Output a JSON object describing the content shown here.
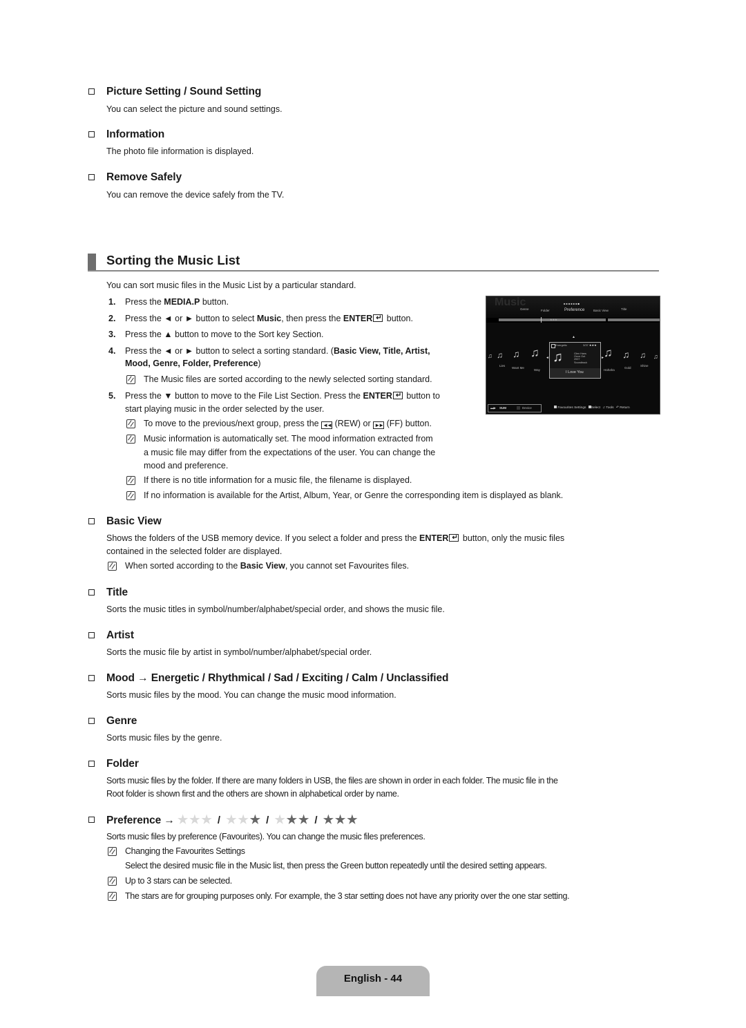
{
  "sections_top": [
    {
      "heading": "Picture Setting / Sound Setting",
      "text": "You can select the picture and sound settings."
    },
    {
      "heading": "Information",
      "text": "The photo file information is displayed."
    },
    {
      "heading": "Remove Safely",
      "text": "You can remove the device safely from the TV."
    }
  ],
  "main": {
    "title": "Sorting the Music List",
    "intro": "You can sort music files in the Music List by a particular standard.",
    "steps": [
      {
        "num": "1.",
        "pre": "Press the ",
        "bold": "MEDIA.P",
        "post": " button."
      },
      {
        "num": "2.",
        "pre": "Press the ◄ or ► button to select ",
        "bold": "Music",
        "mid": ", then press the ",
        "bold2": "ENTER",
        "post": " button."
      },
      {
        "num": "3.",
        "text": "Press the ▲ button to move to the Sort key Section."
      },
      {
        "num": "4.",
        "pre": "Press the ◄ or ► button to select a sorting standard. (",
        "bold": "Basic View, Title, Artist,",
        "line2_bold": "Mood, Genre, Folder, Preference",
        "line2_post": ")"
      },
      {
        "num": "5.",
        "pre": "Press the ▼ button to move to the File List Section. Press the ",
        "bold": "ENTER",
        "post": " button to",
        "line2": "start playing music in the order selected by the user."
      }
    ],
    "notes_step4": [
      "The Music files are sorted according to the newly selected sorting standard."
    ],
    "notes_step5": {
      "rew_ff": {
        "pre": "To move to the previous/next group, press the ",
        "rew": "(REW) or ",
        "ff": "(FF) button."
      },
      "mood": [
        "Music information is automatically set. The mood information extracted from",
        "a music file may differ from the expectations of the user. You can change the",
        "mood and preference."
      ],
      "no_title": "If there is no title information for a music file, the filename is displayed.",
      "no_info": "If no information is available for the Artist, Album, Year, or Genre the corresponding item is displayed as blank."
    }
  },
  "tv_screen": {
    "title": "Music",
    "sort_tabs": [
      "Genre",
      "Folder",
      "Preference",
      "Basic View",
      "Title"
    ],
    "selected_sort": "Preference",
    "group_label": "★★★",
    "tracks_left": [
      "Lies",
      "Want Me",
      "Way"
    ],
    "tracks_right": [
      "Hahaha",
      "Gold",
      "Shine"
    ],
    "selected_track": {
      "mood": "Energetic",
      "count": "3/37",
      "stars": "★★★",
      "artist": "Glen Hans",
      "album": "Once Out",
      "year": "2007",
      "genre": "Soundtrack",
      "title": "I Love You"
    },
    "device": {
      "name": "SUM",
      "label": "Device"
    },
    "footer": [
      "Favourites Settings",
      "Select",
      "Tools",
      "Return"
    ]
  },
  "sort_options": [
    {
      "heading": "Basic View",
      "text_pre": "Shows the folders of the USB memory device. If you select a folder and press the ",
      "text_bold": "ENTER",
      "text_post": " button, only the music files",
      "text_line2": "contained in the selected folder are displayed.",
      "note_pre": "When sorted according to the ",
      "note_bold": "Basic View",
      "note_post": ", you cannot set Favourites files."
    },
    {
      "heading": "Title",
      "text": "Sorts the music titles in symbol/number/alphabet/special order, and shows the music file."
    },
    {
      "heading": "Artist",
      "text": "Sorts the music file by artist in symbol/number/alphabet/special order."
    },
    {
      "heading": "Mood → Energetic / Rhythmical / Sad / Exciting / Calm / Unclassified",
      "text": "Sorts music files by the mood. You can change the music mood information."
    },
    {
      "heading": "Genre",
      "text": "Sorts music files by the genre."
    },
    {
      "heading": "Folder",
      "text": "Sorts music files by the folder. If there are many folders in USB, the files are shown in order in each folder. The music file in the",
      "text_line2": "Root folder is shown first and the others are shown in alphabetical order by name."
    },
    {
      "heading": "Preference →",
      "star_levels": [
        0,
        1,
        2,
        3
      ],
      "text": "Sorts music files by preference (Favourites). You can change the music files preferences."
    }
  ],
  "preference_notes": [
    {
      "text": "Changing the Favourites Settings",
      "sub": "Select the desired music file in the Music list, then press the Green button repeatedly until the desired setting appears."
    },
    {
      "text": "Up to 3 stars can be selected."
    },
    {
      "text": "The stars are for grouping purposes only. For example, the 3 star setting does not have any priority over the one star setting."
    }
  ],
  "footer": {
    "page_label": "English - 44"
  },
  "colors": {
    "page_tab": "#b5b5b5",
    "title_bar": "#6e6e6e",
    "rule": "#888888"
  }
}
